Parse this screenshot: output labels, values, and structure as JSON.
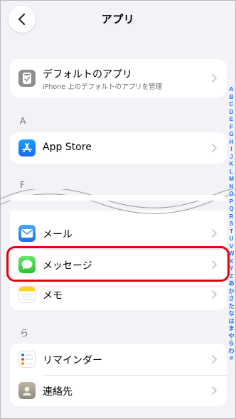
{
  "header": {
    "title": "アプリ"
  },
  "default_apps": {
    "title": "デフォルトのアプリ",
    "subtitle": "iPhone 上のデフォルトのアプリを管理"
  },
  "sections": [
    {
      "header": "A",
      "items": [
        {
          "label": "App Store",
          "icon": "app-store-icon"
        }
      ]
    },
    {
      "header": "F"
    },
    {
      "items": [
        {
          "label": "メール",
          "icon": "mail-icon"
        },
        {
          "label": "メッセージ",
          "icon": "messages-icon"
        },
        {
          "label": "メモ",
          "icon": "notes-icon"
        }
      ]
    },
    {
      "header": "ら",
      "items": [
        {
          "label": "リマインダー",
          "icon": "reminders-icon"
        },
        {
          "label": "連絡先",
          "icon": "contacts-icon"
        }
      ]
    }
  ],
  "index_letters": [
    "A",
    "B",
    "C",
    "D",
    "E",
    "F",
    "G",
    "H",
    "I",
    "J",
    "K",
    "L",
    "M",
    "N",
    "O",
    "P",
    "Q",
    "R",
    "S",
    "T",
    "U",
    "V",
    "W",
    "X",
    "Y",
    "Z",
    "あ",
    "か",
    "さ",
    "た",
    "な",
    "は",
    "ま",
    "や",
    "ら",
    "わ",
    "#"
  ],
  "colors": {
    "background": "#f2f2f7",
    "accent": "#1877f2",
    "highlight": "#e60012"
  }
}
